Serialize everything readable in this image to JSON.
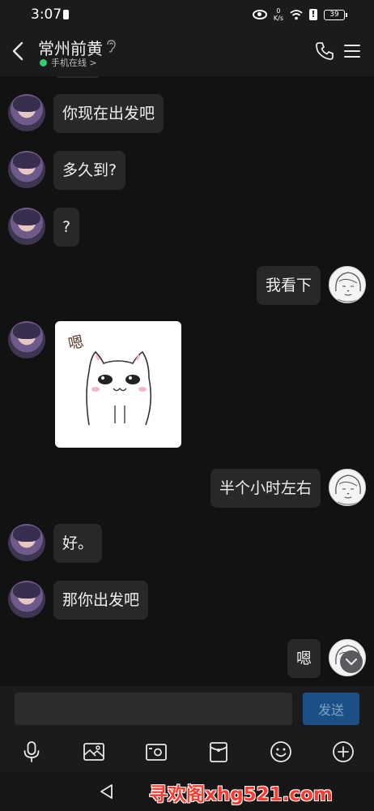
{
  "status_bar": {
    "time": "3:07",
    "net_speed_value": "0",
    "net_speed_unit": "K/s",
    "battery": "39"
  },
  "header": {
    "title": "常州前黄",
    "presence": "手机在线 >",
    "icons": [
      "back-arrow",
      "ear-icon",
      "phone-icon",
      "menu-icon"
    ]
  },
  "messages": [
    {
      "side": "left",
      "type": "text",
      "text": "你现在出发吧"
    },
    {
      "side": "left",
      "type": "text",
      "text": "多久到?"
    },
    {
      "side": "left",
      "type": "text",
      "text": "?"
    },
    {
      "side": "right",
      "type": "text",
      "text": "我看下"
    },
    {
      "side": "left",
      "type": "sticker",
      "text": "嗯"
    },
    {
      "side": "right",
      "type": "text",
      "text": "半个小时左右"
    },
    {
      "side": "left",
      "type": "text",
      "text": "好。"
    },
    {
      "side": "left",
      "type": "text",
      "text": "那你出发吧"
    },
    {
      "side": "right",
      "type": "text",
      "text": "嗯"
    }
  ],
  "composer": {
    "placeholder": "",
    "send_label": "发送"
  },
  "toolbar": {
    "icons": [
      "microphone-icon",
      "image-icon",
      "camera-icon",
      "red-packet-icon",
      "emoji-icon",
      "plus-icon"
    ]
  },
  "watermark": "寻欢阁xhg521.com",
  "colors": {
    "background": "#121213",
    "bubble": "#28282b",
    "send_button": "#1b4f86",
    "online": "#2fd06b",
    "watermark": "#ff3b2f"
  }
}
